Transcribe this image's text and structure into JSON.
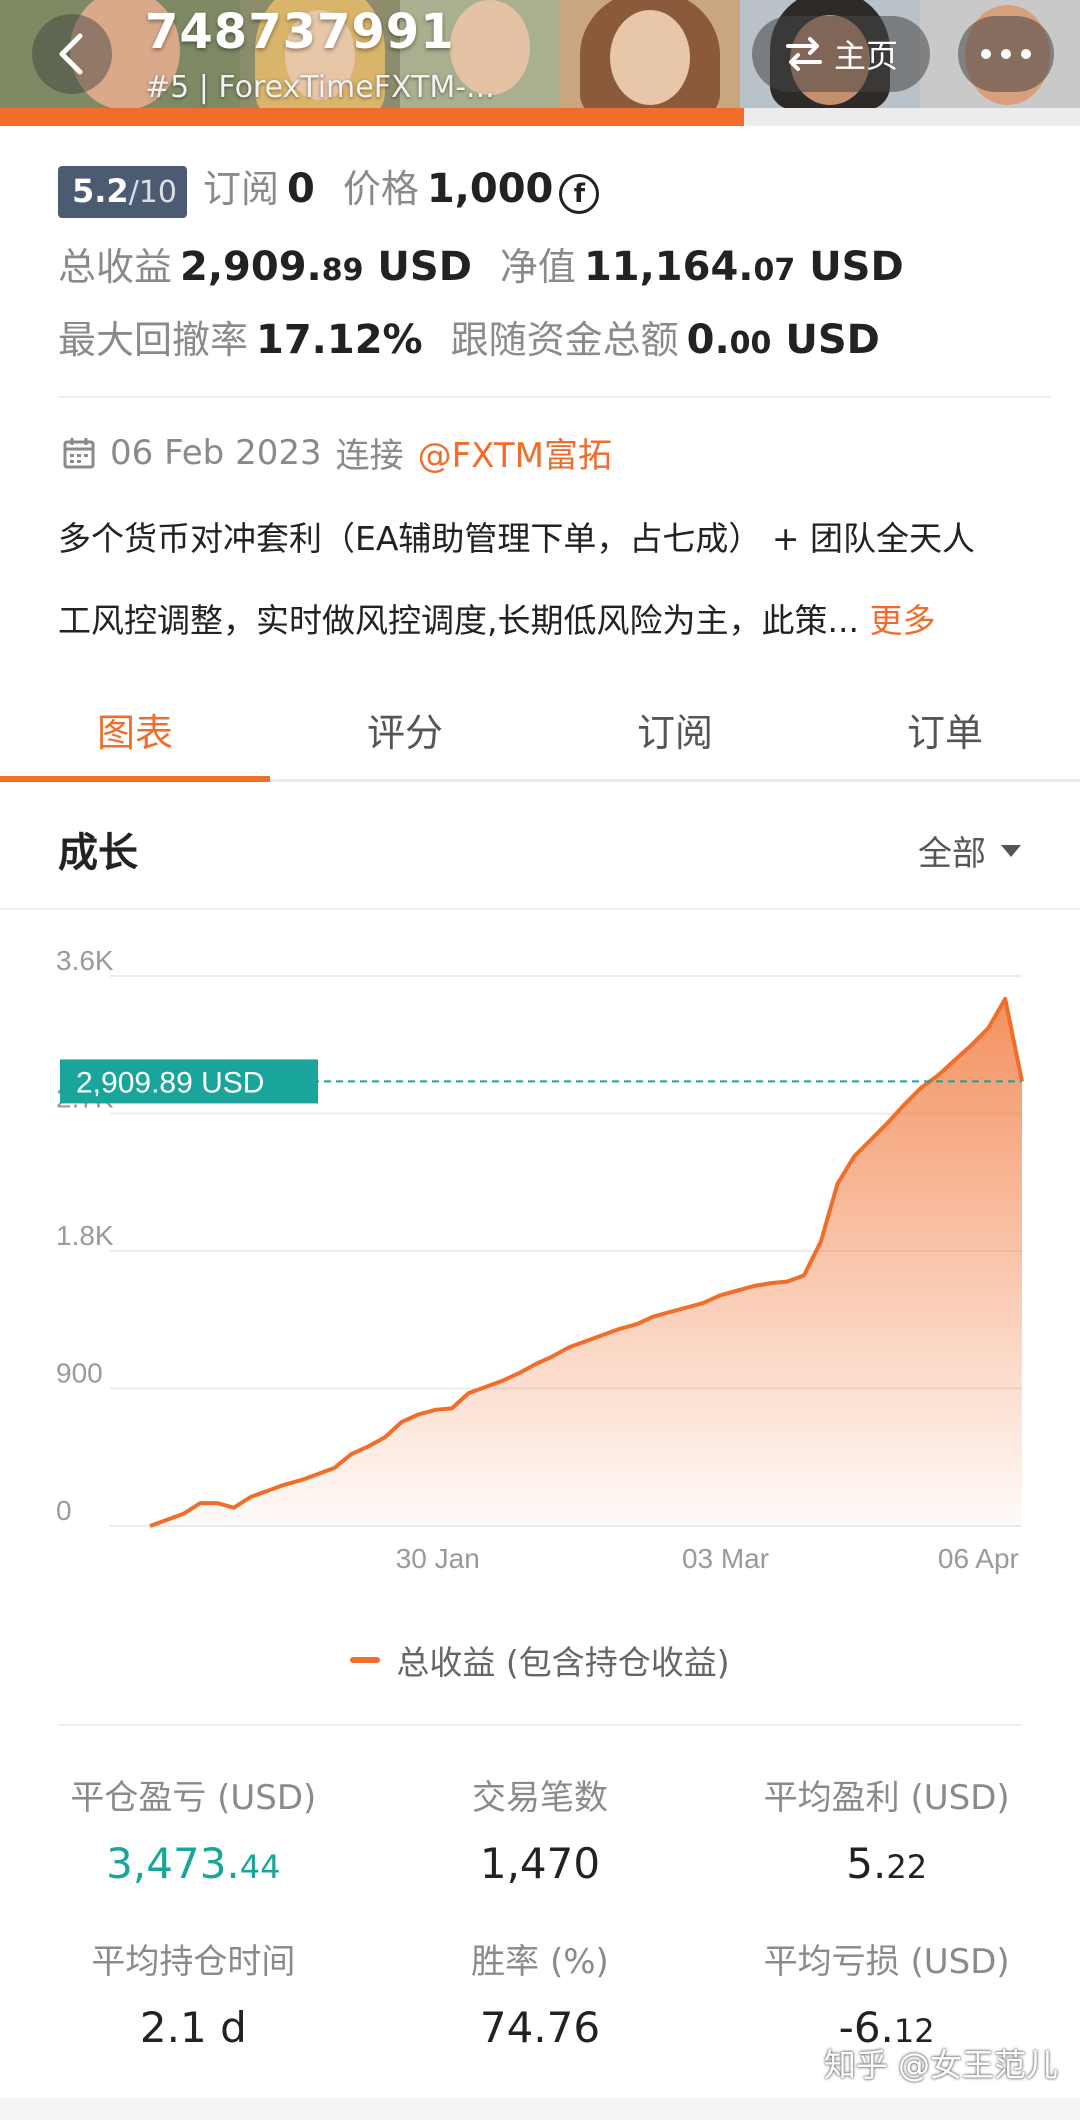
{
  "header": {
    "account_id": "748737991",
    "subtitle": "#5 | ForexTimeFXTM-...",
    "home_label": "主页"
  },
  "stats": {
    "rating": "5.2",
    "rating_denominator": "/10",
    "subscribe_label": "订阅",
    "subscribe_value": "0",
    "price_label": "价格",
    "price_value": "1,000",
    "total_profit_label": "总收益",
    "total_profit_main": "2,909.",
    "total_profit_decimal": "89",
    "total_profit_unit": "USD",
    "equity_label": "净值",
    "equity_main": "11,164.",
    "equity_decimal": "07",
    "equity_unit": "USD",
    "max_drawdown_label": "最大回撤率",
    "max_drawdown_value": "17.12%",
    "follow_funds_label": "跟随资金总额",
    "follow_funds_main": "0.",
    "follow_funds_decimal": "00",
    "follow_funds_unit": "USD"
  },
  "connection": {
    "date": "06 Feb 2023",
    "connect_label": "连接",
    "broker": "@FXTM富拓"
  },
  "description": {
    "line1": "多个货币对冲套利（EA辅助管理下单，占七成） + 团队全天人",
    "line2": "工风控调整，实时做风控调度,长期低风险为主，此策...",
    "more_label": "更多"
  },
  "tabs": [
    {
      "label": "图表",
      "active": true
    },
    {
      "label": "评分",
      "active": false
    },
    {
      "label": "订阅",
      "active": false
    },
    {
      "label": "订单",
      "active": false
    }
  ],
  "growth": {
    "title": "成长",
    "filter_label": "全部"
  },
  "chart_data": {
    "type": "area",
    "y_ticks": [
      "3.6K",
      "2.7K",
      "1.8K",
      "900",
      "0"
    ],
    "y_tick_values": [
      3600,
      2700,
      1800,
      900,
      0
    ],
    "ylim": [
      0,
      3600
    ],
    "x_ticks": [
      "30 Jan",
      "03 Mar",
      "06 Apr"
    ],
    "x_tick_positions": [
      0.33,
      0.66,
      0.95
    ],
    "current_value_label": "2,909.89 USD",
    "current_value": 2909.89,
    "legend": "总收益 (包含持仓收益)",
    "series": [
      {
        "name": "总收益 (包含持仓收益)",
        "color": "#f06d2a",
        "values": [
          0,
          40,
          80,
          150,
          150,
          120,
          190,
          230,
          270,
          300,
          340,
          380,
          470,
          520,
          580,
          680,
          730,
          760,
          770,
          870,
          910,
          950,
          1000,
          1060,
          1110,
          1170,
          1210,
          1250,
          1290,
          1320,
          1370,
          1400,
          1430,
          1460,
          1510,
          1540,
          1570,
          1590,
          1600,
          1640,
          1860,
          2240,
          2420,
          2530,
          2640,
          2760,
          2870,
          2950,
          3050,
          3150,
          3260,
          3450,
          2909.89
        ]
      }
    ]
  },
  "metrics": [
    {
      "label": "平仓盈亏 (USD)",
      "main": "3,473.",
      "decimal": "44",
      "color": "#19a59b"
    },
    {
      "label": "交易笔数",
      "main": "1,470",
      "decimal": ""
    },
    {
      "label": "平均盈利 (USD)",
      "main": "5.",
      "decimal": "22"
    },
    {
      "label": "平均持仓时间",
      "main": "2.1 d",
      "decimal": ""
    },
    {
      "label": "胜率 (%)",
      "main": "74.76",
      "decimal": ""
    },
    {
      "label": "平均亏损 (USD)",
      "main": "-6.",
      "decimal": "12"
    }
  ],
  "watermark": "知乎 @女王范儿"
}
